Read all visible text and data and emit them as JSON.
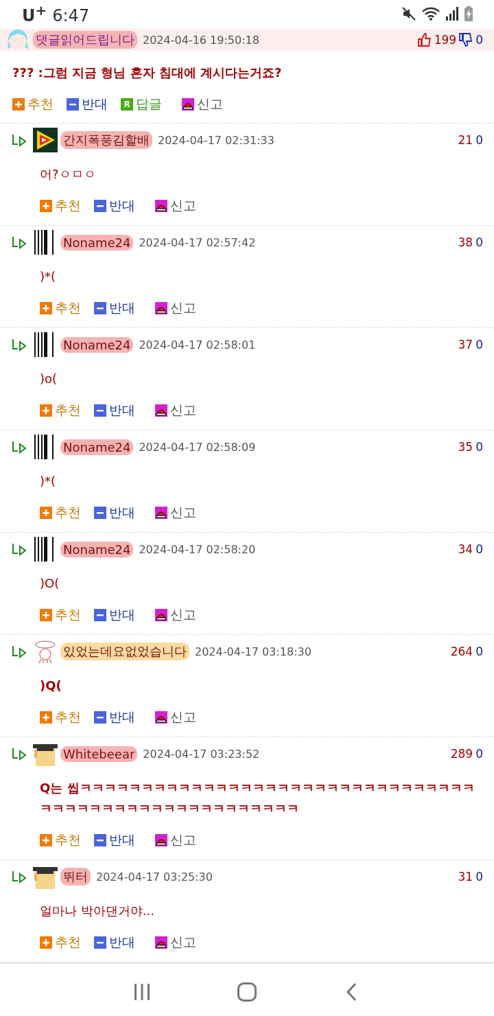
{
  "status_bar": {
    "carrier": "U$^{+}$",
    "time": "6:47"
  },
  "comment": {
    "avatar": {
      "kind": "anime"
    },
    "name": "댓글읽어드립니다",
    "color": "#f6b3b3",
    "date": "2024-04-16 19:50:18",
    "up": "199",
    "down": "0",
    "body": "??? :그럼 지금 형님 혼자 침대에 계시다는거죠?",
    "body_bold": true,
    "actions": [
      {
        "kind": "up",
        "label": "추천"
      },
      {
        "kind": "down",
        "label": "반대"
      },
      {
        "kind": "reply",
        "label": "답글",
        "badge": "R"
      },
      {
        "kind": "report",
        "label": "신고"
      }
    ]
  },
  "replies": [
    {
      "avatar": {
        "kind": "arrow"
      },
      "name": "간지폭풍김할배",
      "color": "#f6b3b3",
      "date": "2024-04-17 02:31:33",
      "up": "21",
      "down": "0",
      "body": "어?ㅇㅁㅇ",
      "body_bold": false,
      "actions": [
        {
          "kind": "up",
          "label": "추천"
        },
        {
          "kind": "down",
          "label": "반대"
        },
        {
          "kind": "report",
          "label": "신고"
        }
      ]
    },
    {
      "avatar": {
        "kind": "barcode"
      },
      "name": "Noname24",
      "color": "#f6b3b3",
      "date": "2024-04-17 02:57:42",
      "up": "38",
      "down": "0",
      "body": ")*(",
      "body_bold": false,
      "actions": [
        {
          "kind": "up",
          "label": "추천"
        },
        {
          "kind": "down",
          "label": "반대"
        },
        {
          "kind": "report",
          "label": "신고"
        }
      ]
    },
    {
      "avatar": {
        "kind": "barcode"
      },
      "name": "Noname24",
      "color": "#f6b3b3",
      "date": "2024-04-17 02:58:01",
      "up": "37",
      "down": "0",
      "body": ")o(",
      "body_bold": false,
      "actions": [
        {
          "kind": "up",
          "label": "추천"
        },
        {
          "kind": "down",
          "label": "반대"
        },
        {
          "kind": "report",
          "label": "신고"
        }
      ]
    },
    {
      "avatar": {
        "kind": "barcode"
      },
      "name": "Noname24",
      "color": "#f6b3b3",
      "date": "2024-04-17 02:58:09",
      "up": "35",
      "down": "0",
      "body": ")*(",
      "body_bold": false,
      "actions": [
        {
          "kind": "up",
          "label": "추천"
        },
        {
          "kind": "down",
          "label": "반대"
        },
        {
          "kind": "report",
          "label": "신고"
        }
      ]
    },
    {
      "avatar": {
        "kind": "barcode"
      },
      "name": "Noname24",
      "color": "#f6b3b3",
      "date": "2024-04-17 02:58:20",
      "up": "34",
      "down": "0",
      "body": ")O(",
      "body_bold": false,
      "actions": [
        {
          "kind": "up",
          "label": "추천"
        },
        {
          "kind": "down",
          "label": "반대"
        },
        {
          "kind": "report",
          "label": "신고"
        }
      ]
    },
    {
      "avatar": {
        "kind": "sketch"
      },
      "name": "있었는데요없었습니다",
      "color": "#f8dca0",
      "date": "2024-04-17 03:18:30",
      "up": "264",
      "down": "0",
      "body": ")Q(",
      "body_bold": true,
      "actions": [
        {
          "kind": "up",
          "label": "추천"
        },
        {
          "kind": "down",
          "label": "반대"
        },
        {
          "kind": "report",
          "label": "신고"
        }
      ]
    },
    {
      "avatar": {
        "kind": "graduate"
      },
      "name": "Whitebeear",
      "color": "#f6b3b3",
      "date": "2024-04-17 03:23:52",
      "up": "289",
      "down": "0",
      "body": "Q는 씹ㅋㅋㅋㅋㅋㅋㅋㅋㅋㅋㅋㅋㅋㅋㅋㅋㅋㅋㅋㅋㅋㅋㅋㅋㅋㅋㅋㅋㅋㅋㅋㅋㅋㅋㅋㅋㅋㅋㅋㅋㅋㅋㅋㅋㅋㅋㅋㅋㅋㅋㅋㅋㅋ",
      "body_bold": true,
      "actions": [
        {
          "kind": "up",
          "label": "추천"
        },
        {
          "kind": "down",
          "label": "반대"
        },
        {
          "kind": "report",
          "label": "신고"
        }
      ]
    },
    {
      "avatar": {
        "kind": "graduate"
      },
      "name": "뛰터",
      "color": "#f6b3b3",
      "date": "2024-04-17 03:25:30",
      "up": "31",
      "down": "0",
      "body": "얼마나 박아댄거야...",
      "body_bold": false,
      "actions": [
        {
          "kind": "up",
          "label": "추천"
        },
        {
          "kind": "down",
          "label": "반대"
        },
        {
          "kind": "report",
          "label": "신고"
        }
      ]
    }
  ]
}
